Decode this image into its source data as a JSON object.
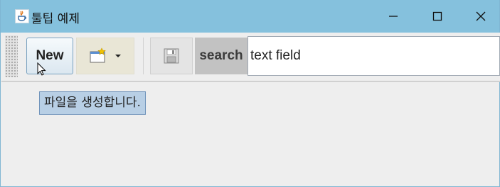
{
  "window": {
    "title": "툴팁 예제",
    "controls": {
      "minimize_icon": "minimize-icon",
      "maximize_icon": "maximize-icon",
      "close_icon": "close-icon"
    }
  },
  "toolbar": {
    "new_label": "New",
    "open_icon": "open-folder-icon",
    "save_icon": "floppy-disk-icon",
    "search_label": "search",
    "search_value": "text field"
  },
  "tooltip": {
    "text": "파일을 생성합니다."
  },
  "colors": {
    "titlebar": "#85c1dd",
    "tooltip_bg": "#b8cfe5",
    "tooltip_border": "#6f93ba",
    "panel": "#eeeeee"
  }
}
